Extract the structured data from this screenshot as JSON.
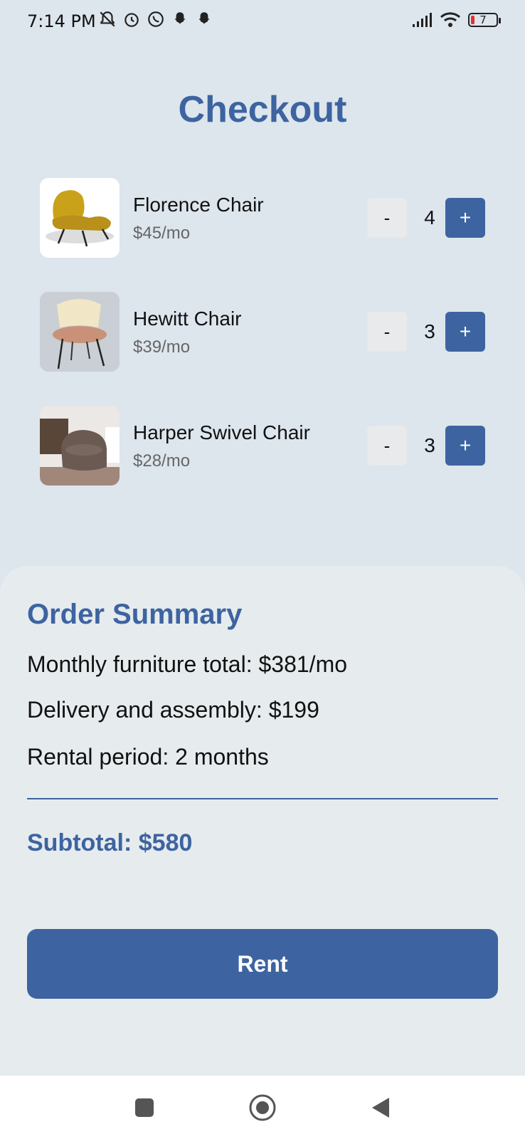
{
  "status_bar": {
    "time": "7:14 PM",
    "battery": "7",
    "icons": [
      "muted-notification-icon",
      "alarm-icon",
      "whatsapp-icon",
      "snapchat-icon",
      "snapchat-icon",
      "signal-icon",
      "wifi-icon",
      "battery-icon"
    ]
  },
  "page": {
    "title": "Checkout"
  },
  "cart": {
    "items": [
      {
        "name": "Florence Chair",
        "price": "$45/mo",
        "quantity": "4",
        "minus": "-",
        "plus": "+"
      },
      {
        "name": "Hewitt Chair",
        "price": "$39/mo",
        "quantity": "3",
        "minus": "-",
        "plus": "+"
      },
      {
        "name": "Harper Swivel Chair",
        "price": "$28/mo",
        "quantity": "3",
        "minus": "-",
        "plus": "+"
      }
    ]
  },
  "summary": {
    "title": "Order Summary",
    "monthly_total": "Monthly furniture total: $381/mo",
    "delivery": "Delivery and assembly: $199",
    "rental_period": "Rental period: 2 months",
    "subtotal": "Subtotal: $580"
  },
  "actions": {
    "rent_label": "Rent"
  },
  "colors": {
    "accent": "#3d64a0",
    "background": "#dde5ed",
    "panel": "#e6ebee"
  }
}
